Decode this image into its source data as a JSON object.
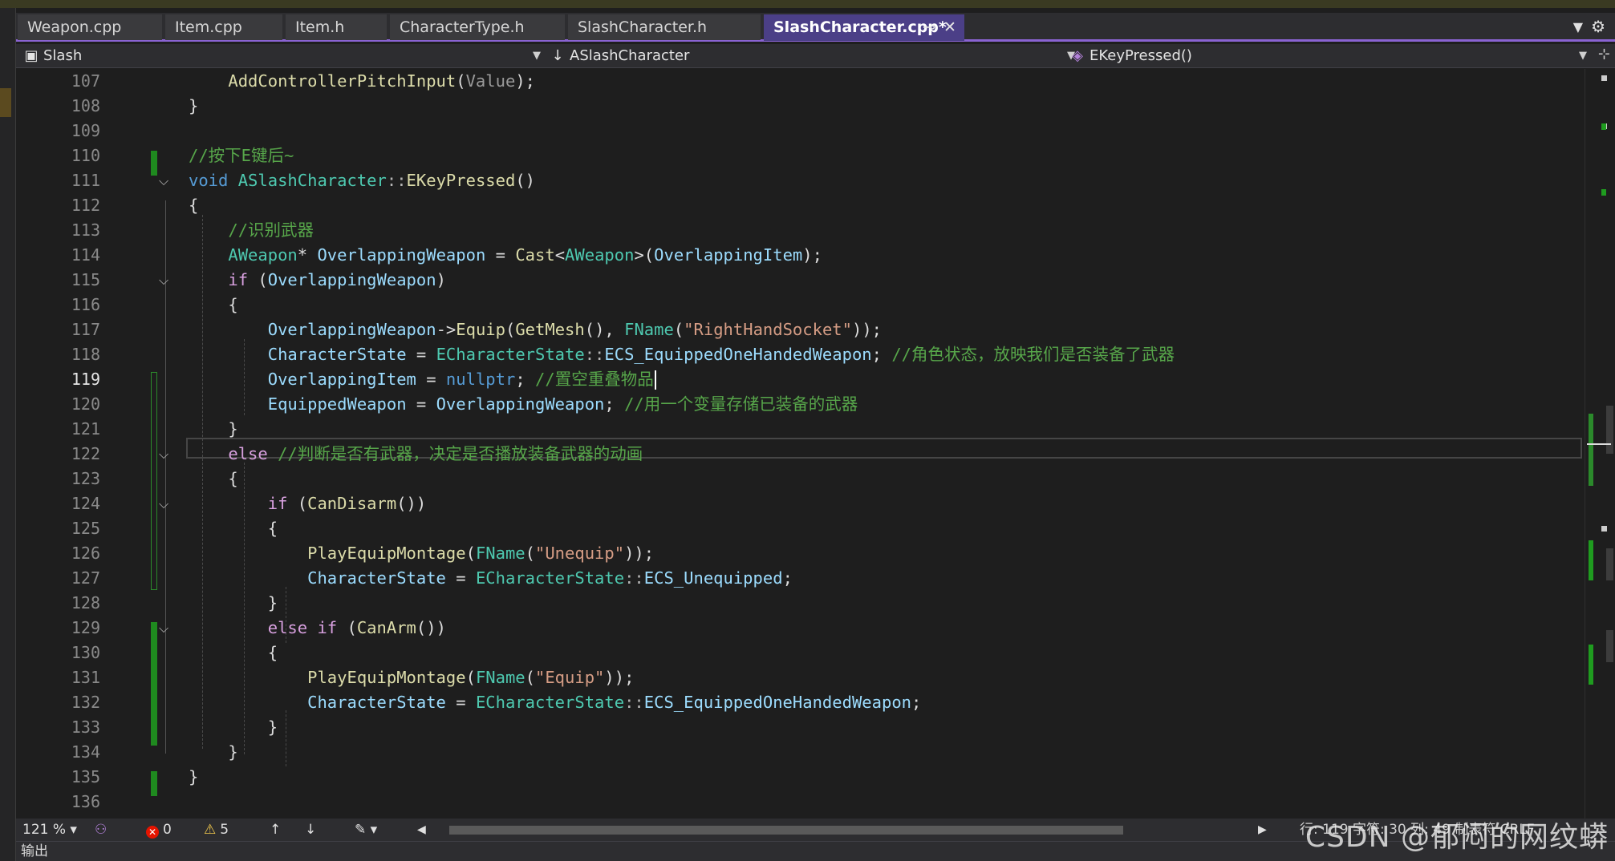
{
  "tabs": [
    {
      "label": "Weapon.cpp",
      "active": false
    },
    {
      "label": "Item.cpp",
      "active": false
    },
    {
      "label": "Item.h",
      "active": false
    },
    {
      "label": "CharacterType.h",
      "active": false
    },
    {
      "label": "SlashCharacter.h",
      "active": false
    },
    {
      "label": "SlashCharacter.cpp*",
      "active": true
    }
  ],
  "tab_pin_glyph": "⊸",
  "tab_close_glyph": "✕",
  "navbar": {
    "project": "Slash",
    "scope": "ASlashCharacter",
    "member": "EKeyPressed()"
  },
  "editor": {
    "current_line": "119",
    "lines": [
      {
        "n": "107",
        "text": "    AddControllerPitchInput(Value);"
      },
      {
        "n": "108",
        "text": "}"
      },
      {
        "n": "109",
        "text": ""
      },
      {
        "n": "110",
        "text": "//按下E键后~"
      },
      {
        "n": "111",
        "text": "void ASlashCharacter::EKeyPressed()"
      },
      {
        "n": "112",
        "text": "{"
      },
      {
        "n": "113",
        "text": "    //识别武器"
      },
      {
        "n": "114",
        "text": "    AWeapon* OverlappingWeapon = Cast<AWeapon>(OverlappingItem);"
      },
      {
        "n": "115",
        "text": "    if (OverlappingWeapon)"
      },
      {
        "n": "116",
        "text": "    {"
      },
      {
        "n": "117",
        "text": "        OverlappingWeapon->Equip(GetMesh(), FName(\"RightHandSocket\"));"
      },
      {
        "n": "118",
        "text": "        CharacterState = ECharacterState::ECS_EquippedOneHandedWeapon; //角色状态，放映我们是否装备了武器"
      },
      {
        "n": "119",
        "text": "        OverlappingItem = nullptr; //置空重叠物品"
      },
      {
        "n": "120",
        "text": "        EquippedWeapon = OverlappingWeapon; //用一个变量存储已装备的武器"
      },
      {
        "n": "121",
        "text": "    }"
      },
      {
        "n": "122",
        "text": "    else //判断是否有武器，决定是否播放装备武器的动画"
      },
      {
        "n": "123",
        "text": "    {"
      },
      {
        "n": "124",
        "text": "        if (CanDisarm())"
      },
      {
        "n": "125",
        "text": "        {"
      },
      {
        "n": "126",
        "text": "            PlayEquipMontage(FName(\"Unequip\"));"
      },
      {
        "n": "127",
        "text": "            CharacterState = ECharacterState::ECS_Unequipped;"
      },
      {
        "n": "128",
        "text": "        }"
      },
      {
        "n": "129",
        "text": "        else if (CanArm())"
      },
      {
        "n": "130",
        "text": "        {"
      },
      {
        "n": "131",
        "text": "            PlayEquipMontage(FName(\"Equip\"));"
      },
      {
        "n": "132",
        "text": "            CharacterState = ECharacterState::ECS_EquippedOneHandedWeapon;"
      },
      {
        "n": "133",
        "text": "        }"
      },
      {
        "n": "134",
        "text": "    }"
      },
      {
        "n": "135",
        "text": "}"
      },
      {
        "n": "136",
        "text": ""
      }
    ]
  },
  "statusbar": {
    "zoom": "121 %",
    "errors": "0",
    "warnings": "5",
    "line_col": "行: 119  字符: 30  列: 49  制表符  CRLF"
  },
  "output_panel": {
    "label": "输出"
  },
  "watermark": "CSDN @郁闷的网纹蟒",
  "colors": {
    "tab_active": "#4b3f87",
    "tab_underline": "#8a63d2",
    "keyword": "#569cd6",
    "control": "#d8a0df",
    "type": "#4ec9b0",
    "function": "#dcdcaa",
    "variable": "#9cdcfe",
    "string": "#d69d85",
    "comment": "#57a64a",
    "change_bar": "#1f8a1f"
  }
}
